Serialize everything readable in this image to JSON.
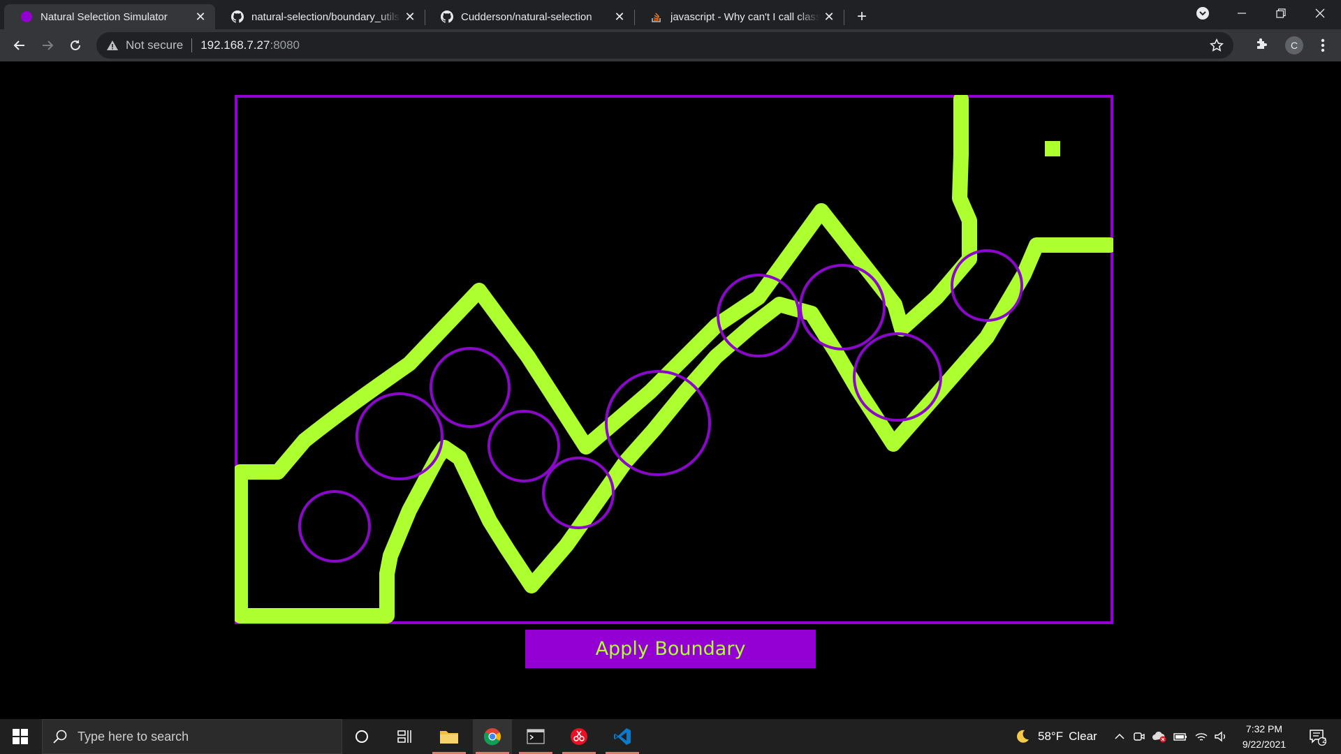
{
  "browser": {
    "tabs": [
      {
        "title": "Natural Selection Simulator",
        "favicon": "purple-circle-icon",
        "active": true
      },
      {
        "title": "natural-selection/boundary_utils.js",
        "favicon": "github-icon",
        "active": false
      },
      {
        "title": "Cudderson/natural-selection",
        "favicon": "github-icon",
        "active": false
      },
      {
        "title": "javascript - Why can't I call class functions",
        "favicon": "stackoverflow-icon",
        "active": false
      }
    ],
    "address": {
      "security_label": "Not secure",
      "host": "192.168.7.27",
      "port": ":8080"
    },
    "profile_initial": "C"
  },
  "page": {
    "apply_button_label": "Apply Boundary",
    "colors": {
      "boundary": "#adff2f",
      "frame": "#9400d3",
      "circle": "#8a08c9",
      "background": "#000000"
    }
  },
  "taskbar": {
    "search_placeholder": "Type here to search",
    "weather_temp": "58°F",
    "weather_condition": "Clear",
    "time": "7:32 PM",
    "date": "9/22/2021",
    "notification_count": "2"
  }
}
